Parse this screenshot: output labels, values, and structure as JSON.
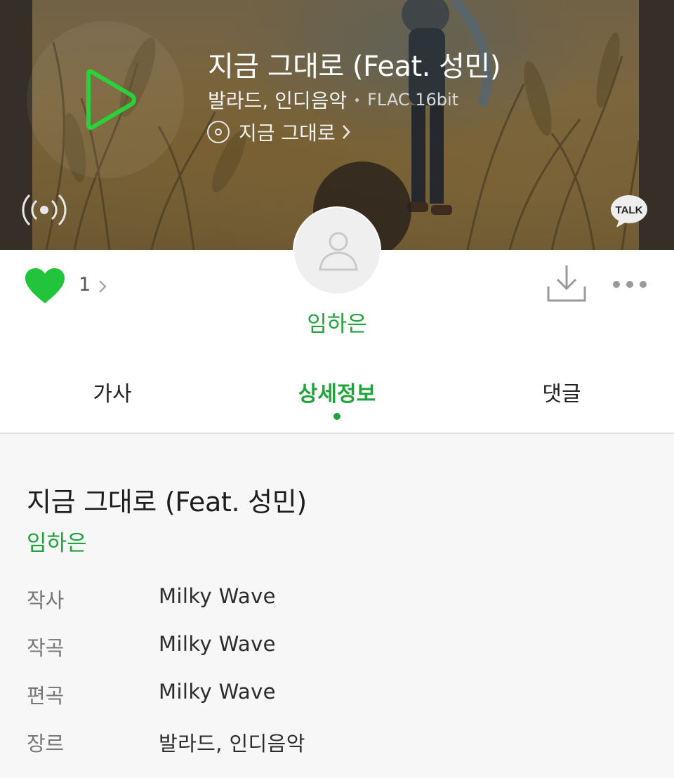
{
  "player": {
    "song_title": "지금 그대로 (Feat. 성민)",
    "genre": "발라드, 인디음악",
    "quality": "FLAC 16bit",
    "album_name": "지금 그대로",
    "talk_label": "TALK",
    "album_art_vertical_text": "임하은"
  },
  "actions": {
    "like_count": "1"
  },
  "artist": {
    "name": "임하은"
  },
  "tabs": [
    {
      "label": "가사"
    },
    {
      "label": "상세정보",
      "active": true
    },
    {
      "label": "댓글"
    }
  ],
  "detail": {
    "title": "지금 그대로 (Feat. 성민)",
    "artist": "임하은",
    "rows": [
      {
        "label": "작사",
        "value": "Milky Wave"
      },
      {
        "label": "작곡",
        "value": "Milky Wave"
      },
      {
        "label": "편곡",
        "value": "Milky Wave"
      },
      {
        "label": "장르",
        "value": "발라드, 인디음악"
      }
    ]
  },
  "colors": {
    "accent": "#21a33b",
    "play_icon": "#2ad13b"
  },
  "icons": {
    "play": "play-icon",
    "album": "disc-icon",
    "live": "broadcast-icon",
    "talk": "kakao-talk-icon",
    "like": "heart-icon",
    "download": "download-icon",
    "more": "more-dots-icon",
    "avatar": "person-icon"
  }
}
